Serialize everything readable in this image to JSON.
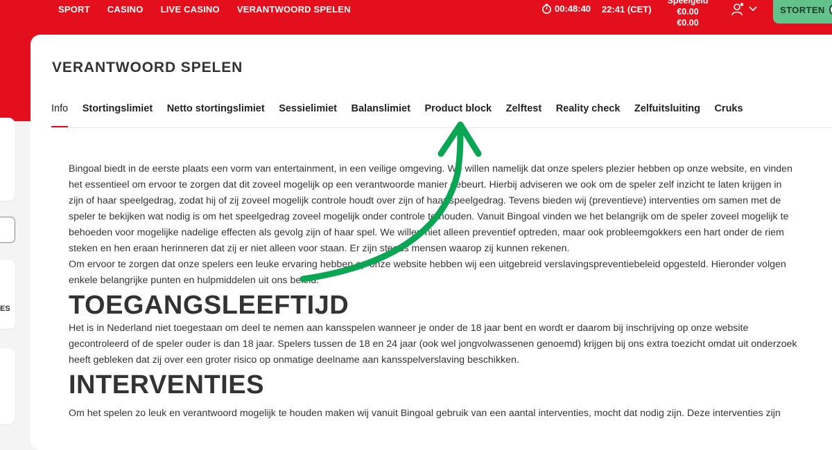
{
  "nav": {
    "items": [
      "SPORT",
      "CASINO",
      "LIVE CASINO",
      "VERANTWOORD SPELEN"
    ]
  },
  "header": {
    "session_timer": "00:48:40",
    "clock": "22:41 (CET)",
    "balance_label": "Speelgeld",
    "balance_primary": "€0.00",
    "balance_secondary": "€0.00",
    "deposit_label": "STORTEN"
  },
  "sidebar": {
    "cut_label": "ES"
  },
  "page": {
    "title": "VERANTWOORD SPELEN",
    "tabs": [
      "Info",
      "Stortingslimiet",
      "Netto stortingslimiet",
      "Sessielimiet",
      "Balanslimiet",
      "Product block",
      "Zelftest",
      "Reality check",
      "Zelfuitsluiting",
      "Cruks"
    ]
  },
  "content": {
    "intro_lines": [
      "Bingoal biedt in de eerste plaats een vorm van entertainment, in een veilige omgeving. We willen namelijk dat onze spelers plezier hebben op onze website, en vinden",
      "het essentieel om ervoor te zorgen dat dit zoveel mogelijk op een verantwoorde manier gebeurt. Hierbij adviseren we ook om de speler zelf inzicht te laten krijgen in",
      "zijn of haar speelgedrag, zodat hij of zij zoveel mogelijk controle houdt over zijn of haar speelgedrag. Tevens bieden wij (preventieve) interventies om samen met de",
      "speler te bekijken wat nodig is om het speelgedrag zoveel mogelijk onder controle te houden. Vanuit Bingoal vinden we het belangrijk om de speler zoveel mogelijk te",
      "behoeden voor mogelijke nadelige effecten als gevolg zijn of haar spel. We willen niet alleen preventief optreden, maar ook probleemgokkers een hart onder de riem",
      "steken en hen eraan herinneren dat zij er niet alleen voor staan. Er zijn steeds mensen waarop zij kunnen rekenen.",
      "Om ervoor te zorgen dat onze spelers een leuke ervaring hebben op onze website hebben wij een uitgebreid verslavingspreventiebeleid opgesteld. Hieronder volgen",
      "enkele belangrijke punten en hulpmiddelen uit ons beleid."
    ],
    "heading1": "TOEGANGSLEEFTIJD",
    "section1_lines": [
      "Het is in Nederland niet toegestaan om deel te nemen aan kansspelen wanneer je onder de 18 jaar bent en wordt er daarom bij inschrijving op onze website",
      "gecontroleerd of de speler ouder is dan 18 jaar. Spelers tussen de 18 en 24 jaar (ook wel jongvolwassenen genoemd) krijgen bij ons extra toezicht omdat uit onderzoek",
      "heeft gebleken dat zij over een groter risico op onmatige deelname aan kansspelverslaving beschikken."
    ],
    "heading2": "INTERVENTIES",
    "section2_line": "Om het spelen zo leuk en verantwoord mogelijk te houden maken wij vanuit Bingoal gebruik van een aantal interventies, mocht dat nodig zijn. Deze interventies zijn"
  },
  "colors": {
    "brand_red": "#e30f1c",
    "deposit_green": "#62c28a",
    "annotation_green": "#0aa654"
  }
}
